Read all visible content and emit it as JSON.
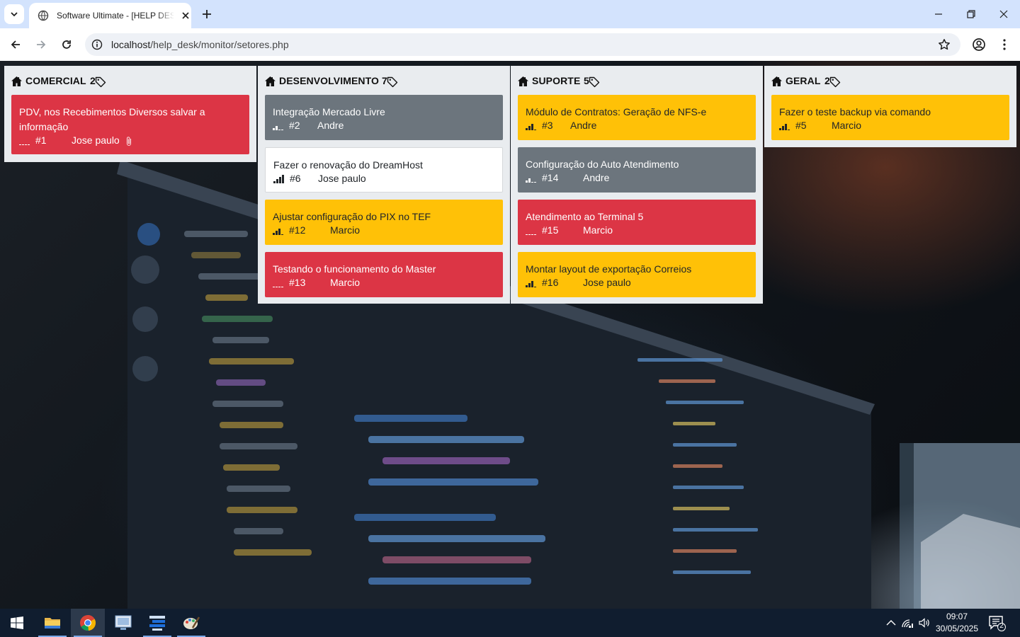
{
  "browser": {
    "tab_title": "Software Ultimate - [HELP DESK]",
    "url_host": "localhost",
    "url_path": "/help_desk/monitor/setores.php"
  },
  "columns": [
    {
      "name": "COMERCIAL",
      "count": "2",
      "cards": [
        {
          "title": "PDV, nos Recebimentos Diversos salvar a informação",
          "number": "#1",
          "user": "Jose paulo",
          "color": "red",
          "signal_level": 0,
          "attachment": true
        }
      ]
    },
    {
      "name": "DESENVOLVIMENTO",
      "count": "7",
      "cards": [
        {
          "title": "Integração Mercado Livre",
          "number": "#2",
          "user": "Andre",
          "color": "gray",
          "signal_level": 2
        },
        {
          "title": "Fazer o renovação do DreamHost",
          "number": "#6",
          "user": "Jose paulo",
          "color": "white",
          "signal_level": 4
        },
        {
          "title": "Ajustar configuração do PIX no TEF",
          "number": "#12",
          "user": "Marcio",
          "color": "yellow",
          "signal_level": 3
        },
        {
          "title": "Testando o funcionamento do Master",
          "number": "#13",
          "user": "Marcio",
          "color": "red",
          "signal_level": 0
        }
      ]
    },
    {
      "name": "SUPORTE",
      "count": "5",
      "cards": [
        {
          "title": "Módulo de Contratos: Geração de NFS-e",
          "number": "#3",
          "user": "Andre",
          "color": "yellow",
          "signal_level": 3
        },
        {
          "title": "Configuração do Auto Atendimento",
          "number": "#14",
          "user": "Andre",
          "color": "gray",
          "signal_level": 2
        },
        {
          "title": "Atendimento ao Terminal 5",
          "number": "#15",
          "user": "Marcio",
          "color": "red",
          "signal_level": 0
        },
        {
          "title": "Montar layout de exportação Correios",
          "number": "#16",
          "user": "Jose paulo",
          "color": "yellow",
          "signal_level": 3
        }
      ]
    },
    {
      "name": "GERAL",
      "count": "2",
      "cards": [
        {
          "title": "Fazer o teste backup via comando",
          "number": "#5",
          "user": "Marcio",
          "color": "yellow",
          "signal_level": 3
        }
      ]
    }
  ],
  "colors": {
    "red": "#dc3545",
    "gray": "#6c757d",
    "yellow": "#ffc107",
    "white": "#ffffff",
    "column_bg": "#e9ecef"
  },
  "taskbar": {
    "apps": [
      "start-icon",
      "file-explorer-icon",
      "chrome-icon",
      "remote-desktop-icon",
      "editor-icon",
      "paint-icon"
    ],
    "time": "09:07",
    "date": "30/05/2025",
    "notification_count": "2"
  }
}
